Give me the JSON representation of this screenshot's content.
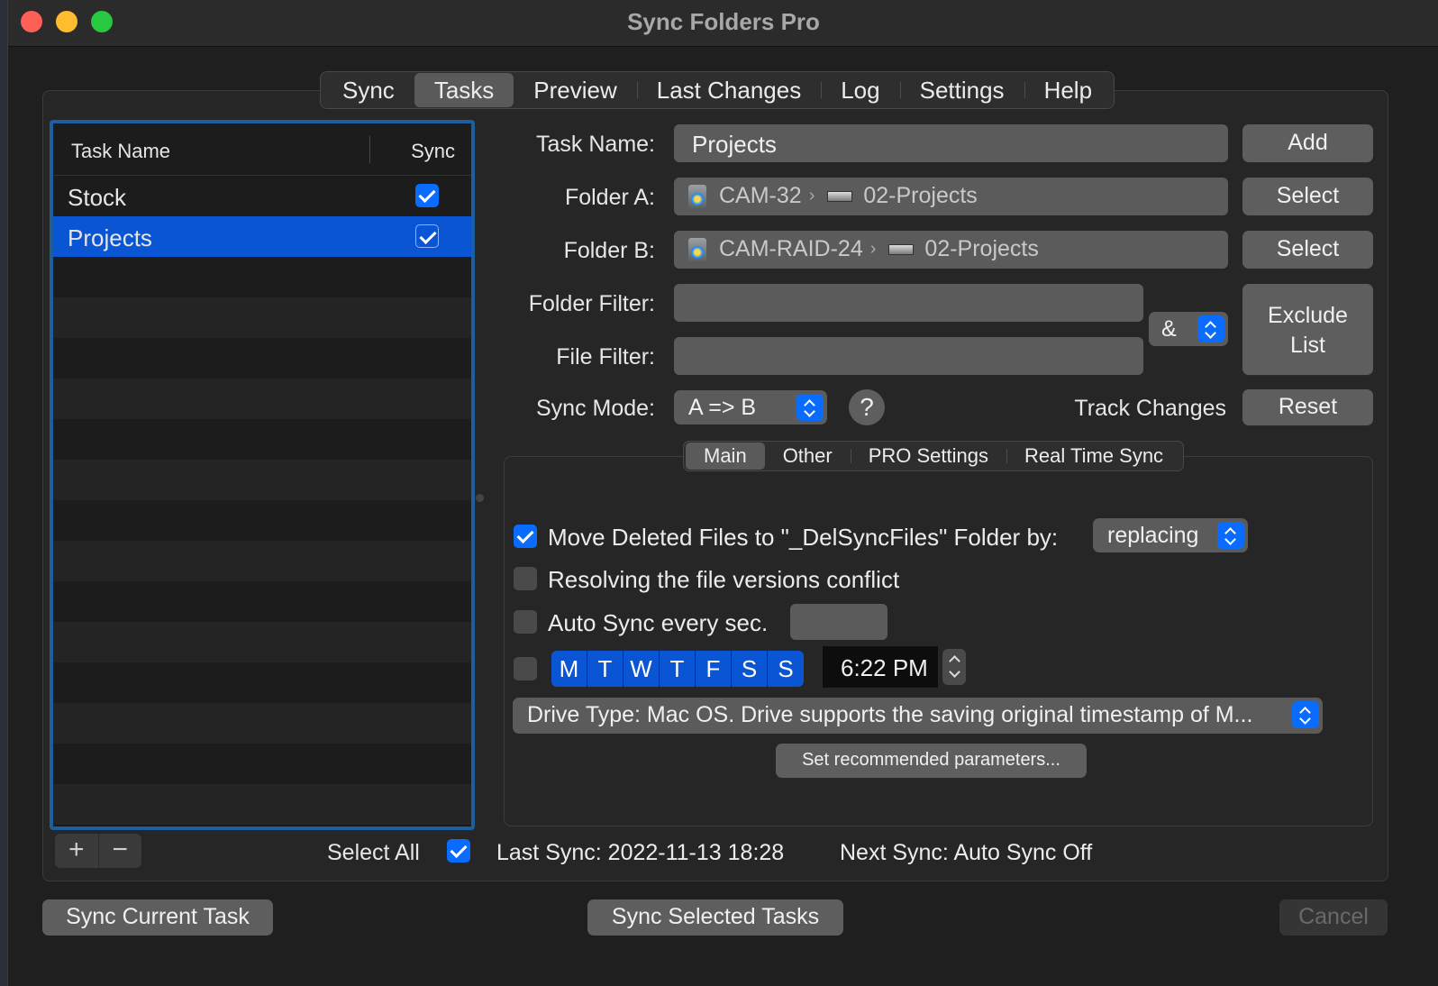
{
  "window": {
    "title": "Sync Folders Pro"
  },
  "main_tabs": [
    "Sync",
    "Tasks",
    "Preview",
    "Last Changes",
    "Log",
    "Settings",
    "Help"
  ],
  "task_list": {
    "col_name": "Task Name",
    "col_sync": "Sync",
    "rows": [
      {
        "name": "Stock",
        "sync": true
      },
      {
        "name": "Projects",
        "sync": true,
        "selected": true
      }
    ],
    "add_label": "+",
    "remove_label": "−",
    "select_all_label": "Select All"
  },
  "form": {
    "task_name_label": "Task Name:",
    "task_name_value": "Projects",
    "add_button": "Add",
    "folder_a_label": "Folder A:",
    "folder_a": {
      "drive": "CAM-32",
      "folder": "02-Projects"
    },
    "folder_b_label": "Folder B:",
    "folder_b": {
      "drive": "CAM-RAID-24",
      "folder": "02-Projects"
    },
    "select_button": "Select",
    "folder_filter_label": "Folder Filter:",
    "file_filter_label": "File Filter:",
    "filter_operator": "&",
    "exclude_list_line1": "Exclude",
    "exclude_list_line2": "List",
    "sync_mode_label": "Sync Mode:",
    "sync_mode_value": "A => B",
    "help_glyph": "?",
    "track_changes_label": "Track Changes",
    "reset_button": "Reset"
  },
  "sub_tabs": [
    "Main",
    "Other",
    "PRO Settings",
    "Real Time Sync"
  ],
  "main_options": {
    "move_deleted_label": "Move Deleted Files to \"_DelSyncFiles\" Folder by:",
    "move_deleted_mode": "replacing",
    "resolving_label": "Resolving the file versions conflict",
    "auto_sync_label": "Auto Sync every sec.",
    "auto_sync_value": "",
    "days": [
      "M",
      "T",
      "W",
      "T",
      "F",
      "S",
      "S"
    ],
    "schedule_time": "6:22 PM",
    "drive_type": "Drive Type: Mac OS. Drive supports the saving original timestamp of M...",
    "recommended_button": "Set recommended parameters..."
  },
  "status": {
    "last_sync": "Last Sync: 2022-11-13 18:28",
    "next_sync": "Next Sync: Auto Sync Off"
  },
  "bottom": {
    "sync_current": "Sync Current Task",
    "sync_selected": "Sync Selected Tasks",
    "cancel": "Cancel"
  }
}
